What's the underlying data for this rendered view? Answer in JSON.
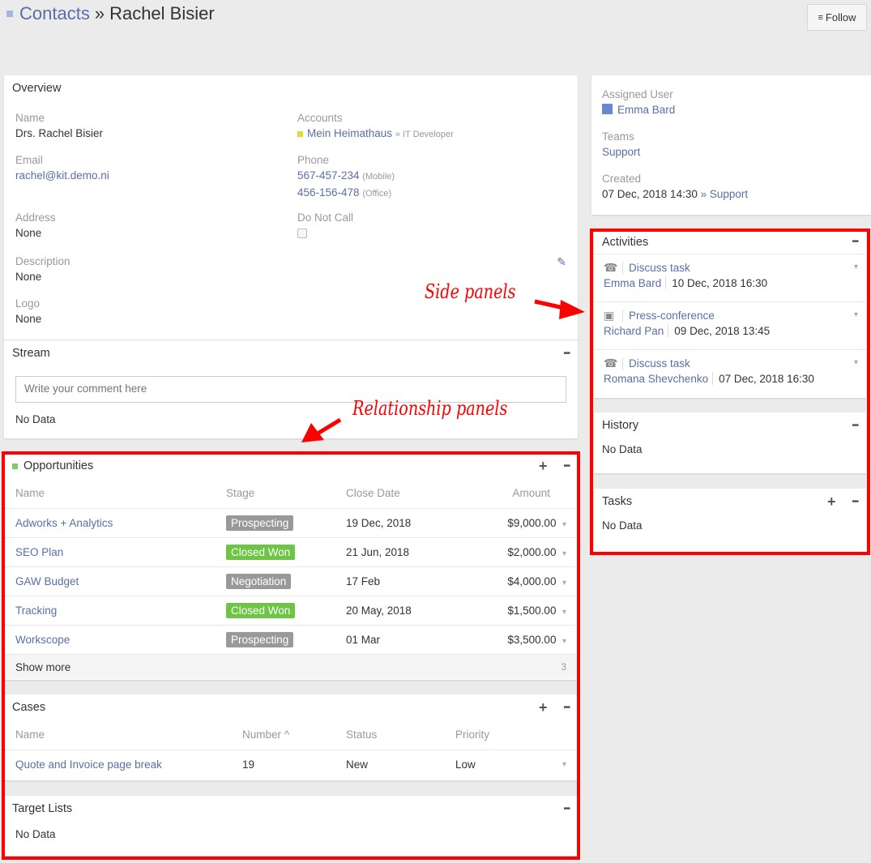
{
  "header": {
    "breadcrumb_root": "Contacts",
    "separator": "»",
    "record_name": "Rachel Bisier",
    "follow_label": "Follow"
  },
  "overview": {
    "title": "Overview",
    "name_label": "Name",
    "name_value": "Drs. Rachel Bisier",
    "email_label": "Email",
    "email_value": "rachel@kit.demo.ni",
    "accounts_label": "Accounts",
    "account_name": "Mein Heimathaus",
    "account_role": "» IT Developer",
    "phone_label": "Phone",
    "phones": [
      {
        "number": "567-457-234",
        "type": "(Mobile)"
      },
      {
        "number": "456-156-478",
        "type": "(Office)"
      }
    ],
    "address_label": "Address",
    "address_value": "None",
    "do_not_call_label": "Do Not Call",
    "description_label": "Description",
    "description_value": "None",
    "logo_label": "Logo",
    "logo_value": "None"
  },
  "stream": {
    "title": "Stream",
    "comment_placeholder": "Write your comment here",
    "empty": "No Data"
  },
  "opportunities": {
    "title": "Opportunities",
    "columns": [
      "Name",
      "Stage",
      "Close Date",
      "Amount"
    ],
    "rows": [
      {
        "name": "Adworks + Analytics",
        "stage": "Prospecting",
        "close_date": "19 Dec, 2018",
        "amount": "$9,000.00"
      },
      {
        "name": "SEO Plan",
        "stage": "Closed Won",
        "close_date": "21 Jun, 2018",
        "amount": "$2,000.00"
      },
      {
        "name": "GAW Budget",
        "stage": "Negotiation",
        "close_date": "17 Feb",
        "amount": "$4,000.00"
      },
      {
        "name": "Tracking",
        "stage": "Closed Won",
        "close_date": "20 May, 2018",
        "amount": "$1,500.00"
      },
      {
        "name": "Workscope",
        "stage": "Prospecting",
        "close_date": "01 Mar",
        "amount": "$3,500.00"
      }
    ],
    "show_more_label": "Show more",
    "remaining_count": "3"
  },
  "cases": {
    "title": "Cases",
    "columns": [
      "Name",
      "Number ^",
      "Status",
      "Priority"
    ],
    "rows": [
      {
        "name": "Quote and Invoice page break",
        "number": "19",
        "status": "New",
        "priority": "Low"
      }
    ]
  },
  "target_lists": {
    "title": "Target Lists",
    "empty": "No Data"
  },
  "side_info": {
    "assigned_user_label": "Assigned User",
    "assigned_user": "Emma Bard",
    "teams_label": "Teams",
    "team": "Support",
    "created_label": "Created",
    "created_date": "07 Dec, 2018 14:30",
    "created_by": "» Support"
  },
  "activities": {
    "title": "Activities",
    "items": [
      {
        "icon": "phone-icon",
        "subject": "Discuss task",
        "user": "Emma Bard",
        "datetime": "10 Dec, 2018 16:30"
      },
      {
        "icon": "briefcase-icon",
        "subject": "Press-conference",
        "user": "Richard Pan",
        "datetime": "09 Dec, 2018 13:45"
      },
      {
        "icon": "phone-icon",
        "subject": "Discuss task",
        "user": "Romana Shevchenko",
        "datetime": "07 Dec, 2018 16:30"
      }
    ]
  },
  "history": {
    "title": "History",
    "empty": "No Data"
  },
  "tasks": {
    "title": "Tasks",
    "empty": "No Data"
  },
  "annotations": {
    "side_panels": "Side panels",
    "relationship_panels": "Relationship panels"
  },
  "colors": {
    "link": "#5a6fa8",
    "stage_prospecting": "#999999",
    "stage_negotiation": "#999999",
    "stage_closed_won": "#6cc644",
    "annotation": "#ff0000",
    "account_marker": "#e5d932",
    "opportunity_marker": "#7ec96b"
  }
}
